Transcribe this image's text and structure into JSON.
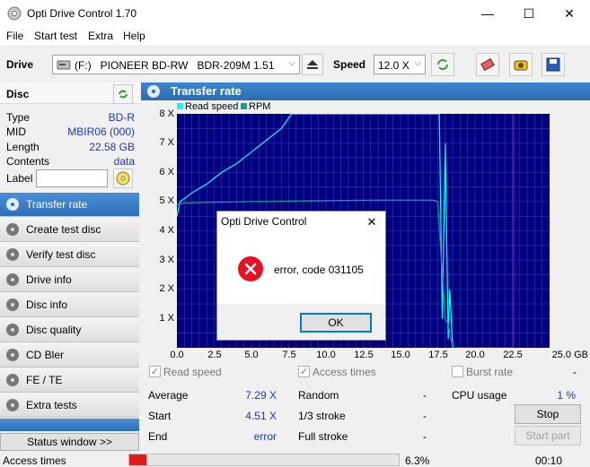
{
  "window": {
    "title": "Opti Drive Control 1.70",
    "minimize": "—",
    "maximize": "☐",
    "close": "✕"
  },
  "menu": [
    "File",
    "Start test",
    "Extra",
    "Help"
  ],
  "drivebar": {
    "drive_label": "Drive",
    "drive_value": "(F:)   PIONEER BD-RW   BDR-209M 1.51",
    "speed_label": "Speed",
    "speed_value": "12.0 X"
  },
  "disc": {
    "header": "Disc",
    "type_label": "Type",
    "type_value": "BD-R",
    "mid_label": "MID",
    "mid_value": "MBIR06 (000)",
    "length_label": "Length",
    "length_value": "22.58 GB",
    "contents_label": "Contents",
    "contents_value": "data",
    "label_label": "Label",
    "label_value": ""
  },
  "nav": [
    {
      "label": "Transfer rate",
      "active": true
    },
    {
      "label": "Create test disc"
    },
    {
      "label": "Verify test disc"
    },
    {
      "label": "Drive info"
    },
    {
      "label": "Disc info"
    },
    {
      "label": "Disc quality"
    },
    {
      "label": "CD Bler"
    },
    {
      "label": "FE / TE"
    },
    {
      "label": "Extra tests"
    }
  ],
  "status_window_label": "Status window >>",
  "chart_header": "Transfer rate",
  "chart_data": {
    "type": "line",
    "legend": [
      {
        "name": "Read speed",
        "color": "#00ffff"
      },
      {
        "name": "RPM",
        "color": "#1c9a8a"
      }
    ],
    "y_ticks": [
      "8 X",
      "7 X",
      "6 X",
      "5 X",
      "4 X",
      "3 X",
      "2 X",
      "1 X"
    ],
    "x_ticks": [
      "0.0",
      "2.5",
      "5.0",
      "7.5",
      "10.0",
      "12.5",
      "15.0",
      "17.5",
      "20.0",
      "22.5",
      "25.0 GB"
    ],
    "xlim": [
      0,
      25
    ],
    "ylim": [
      0,
      8
    ],
    "series": [
      {
        "name": "Read speed",
        "x": [
          0,
          0.2,
          0.5,
          1,
          2,
          3,
          4,
          5,
          6,
          7,
          7.7,
          8,
          17.6,
          17.8,
          18.0,
          18.2,
          18.3,
          18.5
        ],
        "y": [
          4.5,
          5.0,
          5.1,
          5.3,
          5.6,
          6.0,
          6.3,
          6.7,
          7.1,
          7.5,
          8.0,
          8.0,
          8.0,
          1.0,
          7.0,
          0.3,
          2.0,
          0.0
        ]
      },
      {
        "name": "RPM",
        "x": [
          0,
          0.5,
          2,
          5,
          8,
          11,
          14,
          17.2,
          17.5,
          17.8,
          18.0,
          18.2,
          18.4
        ],
        "y": [
          4.9,
          4.95,
          4.97,
          5.0,
          5.02,
          5.04,
          5.05,
          5.05,
          5.0,
          2.5,
          1.0,
          0.8,
          0.2
        ]
      },
      {
        "name": "error region",
        "color": "#ff0000",
        "x": [
          18.5,
          22.5
        ],
        "y": [
          0,
          0
        ]
      }
    ]
  },
  "stats": {
    "read_speed_label": "Read speed",
    "access_times_label": "Access times",
    "burst_rate_label": "Burst rate",
    "burst_rate_value": "-",
    "average_label": "Average",
    "average_value": "7.29 X",
    "start_label": "Start",
    "start_value": "4.51 X",
    "end_label": "End",
    "end_value": "error",
    "random_label": "Random",
    "random_value": "-",
    "third_stroke_label": "1/3 stroke",
    "third_stroke_value": "-",
    "full_stroke_label": "Full stroke",
    "full_stroke_value": "-",
    "cpu_label": "CPU usage",
    "cpu_value": "1 %",
    "stop_button": "Stop",
    "start_part_button": "Start part"
  },
  "dialog": {
    "title": "Opti Drive Control",
    "message": "error, code 031105",
    "ok_button": "OK",
    "close": "✕"
  },
  "statusbar": {
    "label": "Access times",
    "progress_percent": 6.3,
    "progress_text": "6.3%",
    "time": "00:10"
  }
}
